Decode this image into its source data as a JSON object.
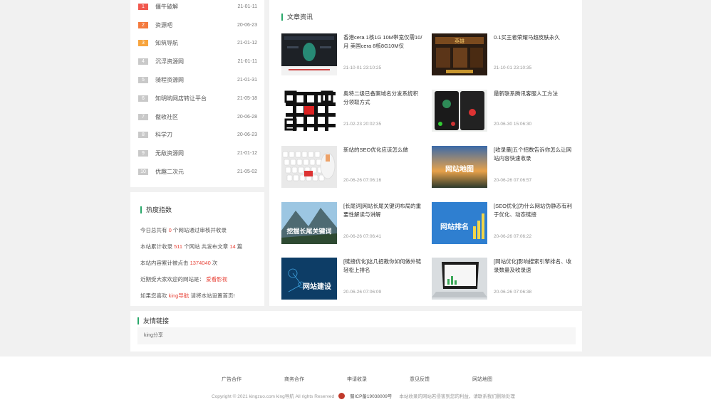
{
  "ranking": [
    {
      "num": "1",
      "name": "僵牛破解",
      "date": "21-01-11"
    },
    {
      "num": "2",
      "name": "资源吧",
      "date": "20-06-23"
    },
    {
      "num": "3",
      "name": "知筑导航",
      "date": "21-01-12"
    },
    {
      "num": "4",
      "name": "沉浮资源网",
      "date": "21-01-11"
    },
    {
      "num": "5",
      "name": "骑程资源网",
      "date": "21-01-31"
    },
    {
      "num": "6",
      "name": "知明哟网店转让平台",
      "date": "21-05-18"
    },
    {
      "num": "7",
      "name": "傲收社区",
      "date": "20-06-28"
    },
    {
      "num": "8",
      "name": "科学刀",
      "date": "20-06-23"
    },
    {
      "num": "9",
      "name": "无敌资源网",
      "date": "21-01-12"
    },
    {
      "num": "10",
      "name": "优趣二次元",
      "date": "21-05-02"
    }
  ],
  "heat": {
    "title": "热度指数",
    "line1_pre": "今日总共有",
    "line1_num": "0",
    "line1_post": "个网站通过审核并收录",
    "line2_pre": "本站累计收录",
    "line2_num1": "511",
    "line2_mid": "个网站 共发布文章",
    "line2_num2": "14",
    "line2_post": "篇",
    "line3_pre": "本站内容累计被点击",
    "line3_num": "1374040",
    "line3_post": "次",
    "line4_pre": "近期受大家欢迎的网站是：",
    "line4_site": "爱看影视",
    "line5_pre": "如果您喜欢",
    "line5_site": "king导航",
    "line5_post": "请将本站设置首页!"
  },
  "articles": {
    "title": "文章资讯",
    "items": [
      {
        "title": "香港cera 1核1G 10M带宽仅需10/月 美国cera 8核8G10M仅",
        "date": "21-10-01 23:10:25",
        "thumb": "dark-server"
      },
      {
        "title": "0.1买王者荣耀马超皮肤永久",
        "date": "21-10-01 23:10:35",
        "thumb": "game"
      },
      {
        "title": "奥特二级已备案域名分发系统积分领取方式",
        "date": "21-02-23 20:02:35",
        "thumb": "qr"
      },
      {
        "title": "最新联系腾讯客服人工方法",
        "date": "20-06-30 15:06:30",
        "thumb": "phone"
      },
      {
        "title": "新站的SEO优化应该怎么做",
        "date": "20-06-26 07:06:16",
        "thumb": "keyboard"
      },
      {
        "title": "[收录量]五个招数告诉你怎么让网站内容快速收录",
        "date": "20-06-26 07:06:57",
        "thumb": "sitemap"
      },
      {
        "title": "[长尾词]网站长尾关键词布局的重要性解读与讲解",
        "date": "20-06-26 07:06:41",
        "thumb": "mountain"
      },
      {
        "title": "[SEO优化]为什么网站伪静态有利于优化、动态链接",
        "date": "20-06-26 07:06:22",
        "thumb": "rank"
      },
      {
        "title": "[链接优化]这几招教你如何做外链轻松上排名",
        "date": "20-06-26 07:06:09",
        "thumb": "build"
      },
      {
        "title": "[网站优化]影响搜索引擎排名、收录数量及收录速",
        "date": "20-06-26 07:06:38",
        "thumb": "laptop"
      }
    ],
    "thumb_text": {
      "sitemap": "网站地图",
      "mountain": "挖掘长尾关键词",
      "rank": "网站排名",
      "build": "网站建设"
    }
  },
  "links": {
    "title": "友情链接",
    "items": [
      "king分享"
    ]
  },
  "footer": {
    "links": [
      "广告合作",
      "商务合作",
      "申请收录",
      "意见反馈",
      "网站地图"
    ],
    "copyright": "Copyright © 2021 kingzuo.com king导航 All rights Reserved",
    "icp": "蜀ICP备19038009号",
    "note": "本站收录的网站若侵害到您的利益，请联系我们删除处理"
  },
  "colors": {
    "accent": "#29a86a",
    "highlight": "#e8463b"
  }
}
